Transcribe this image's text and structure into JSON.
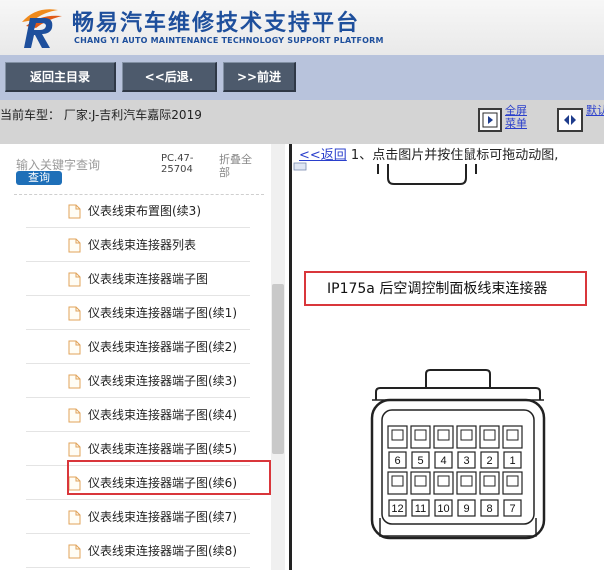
{
  "header": {
    "title": "畅易汽车维修技术支持平台",
    "subtitle": "CHANG YI AUTO MAINTENANCE TECHNOLOGY SUPPORT PLATFORM"
  },
  "toolbar": {
    "home_label": "返回主目录",
    "back_label": "<<后退.",
    "forward_label": ">>前进"
  },
  "infobar": {
    "car_label": "当前车型：  厂家:J-吉利汽车嘉际2019",
    "fullscreen_label": "全屏菜单",
    "side_label": "默认视图"
  },
  "sidebar": {
    "search_hint": "输入关键字查询",
    "search_button": "查询",
    "pc_code": "PC.47-25704",
    "collapse_all": "折叠全部",
    "items": [
      "仪表线束布置图(续3)",
      "仪表线束连接器列表",
      "仪表线束连接器端子图",
      "仪表线束连接器端子图(续1)",
      "仪表线束连接器端子图(续2)",
      "仪表线束连接器端子图(续3)",
      "仪表线束连接器端子图(续4)",
      "仪表线束连接器端子图(续5)",
      "仪表线束连接器端子图(续6)",
      "仪表线束连接器端子图(续7)",
      "仪表线束连接器端子图(续8)"
    ]
  },
  "content": {
    "back_link": "<<返回",
    "instruction": " 1、点击图片并按住鼠标可拖动动图,",
    "diagram_label": "IP175a 后空调控制面板线束连接器",
    "top_pins": [
      "6",
      "5",
      "4",
      "3",
      "2",
      "1"
    ],
    "bottom_pins": [
      "12",
      "11",
      "10",
      "9",
      "8",
      "7"
    ]
  }
}
